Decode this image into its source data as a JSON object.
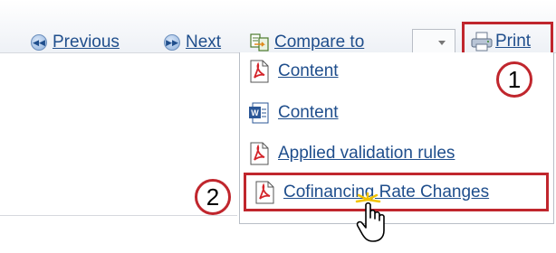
{
  "toolbar": {
    "previous_label": "Previous",
    "next_label": "Next",
    "compare_label": "Compare to",
    "compare_select_value": "",
    "print_label": "Print"
  },
  "print_menu": {
    "items": [
      {
        "label": "Content",
        "icon": "pdf-icon"
      },
      {
        "label": "Content",
        "icon": "word-icon"
      },
      {
        "label": "Applied validation rules",
        "icon": "pdf-icon"
      },
      {
        "label": "Cofinancing Rate Changes",
        "icon": "pdf-icon"
      }
    ]
  },
  "callouts": [
    "1",
    "2"
  ],
  "colors": {
    "link": "#1f4e8c",
    "highlight_border": "#c0262d",
    "pdf_red": "#d4242a"
  }
}
